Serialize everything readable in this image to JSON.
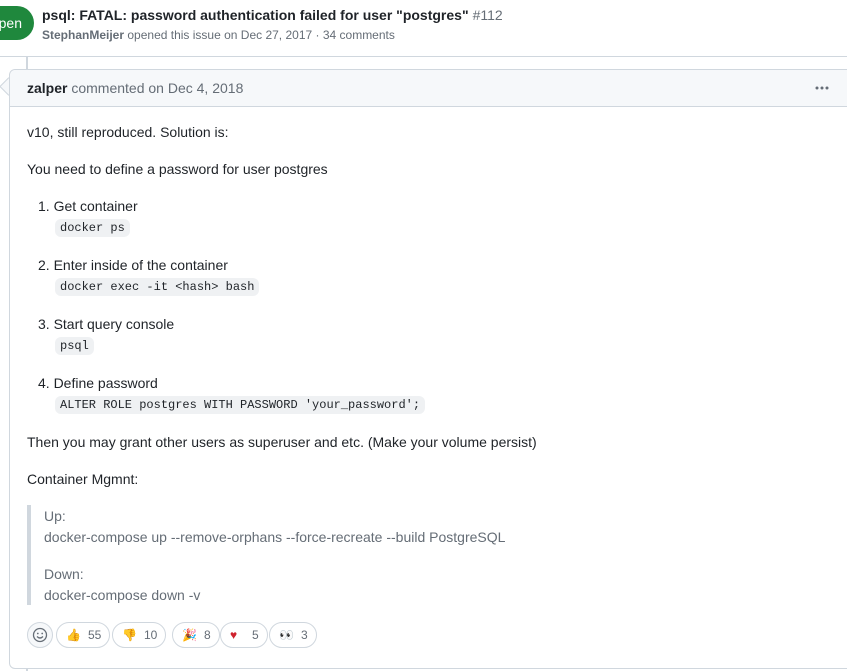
{
  "issue": {
    "state": "Open",
    "state_visible": "pen",
    "title": "psql: FATAL: password authentication failed for user \"postgres\"",
    "number": "#112",
    "author": "StephanMeijer",
    "opened_text": "opened this issue on Dec 27, 2017 · 34 comments"
  },
  "comment": {
    "author": "zalper",
    "action": "commented on Dec 4, 2018",
    "menu_icon": "kebab-horizontal-icon",
    "intro": "v10, still reproduced. Solution is:",
    "define": "You need to define a password for user postgres",
    "steps": [
      {
        "label": "1. Get container",
        "code": "docker ps"
      },
      {
        "label": "2. Enter inside of the container",
        "code": "docker exec -it <hash> bash"
      },
      {
        "label": "3. Start query console",
        "code": "psql"
      },
      {
        "label": "4. Define password",
        "code": "ALTER ROLE postgres WITH PASSWORD 'your_password';"
      }
    ],
    "then": "Then you may grant other users as superuser and etc. (Make your volume persist)",
    "mgmt": "Container Mgmnt:",
    "quote": {
      "up_label": "Up:",
      "up_cmd": "docker-compose up --remove-orphans --force-recreate --build PostgreSQL",
      "down_label": "Down:",
      "down_cmd": "docker-compose down -v"
    }
  },
  "reactions": [
    {
      "icon": "thumbs-up-icon",
      "emoji": "👍",
      "count": "55"
    },
    {
      "icon": "thumbs-down-icon",
      "emoji": "👎",
      "count": "10"
    },
    {
      "icon": "tada-icon",
      "emoji": "🎉",
      "count": "8"
    },
    {
      "icon": "heart-icon",
      "emoji": "♥",
      "count": "5"
    },
    {
      "icon": "eyes-icon",
      "emoji": "👀",
      "count": "3"
    }
  ],
  "colors": {
    "open_green": "#1f883d",
    "border": "#d0d7de",
    "muted": "#656d76",
    "heart": "#cf222e"
  }
}
